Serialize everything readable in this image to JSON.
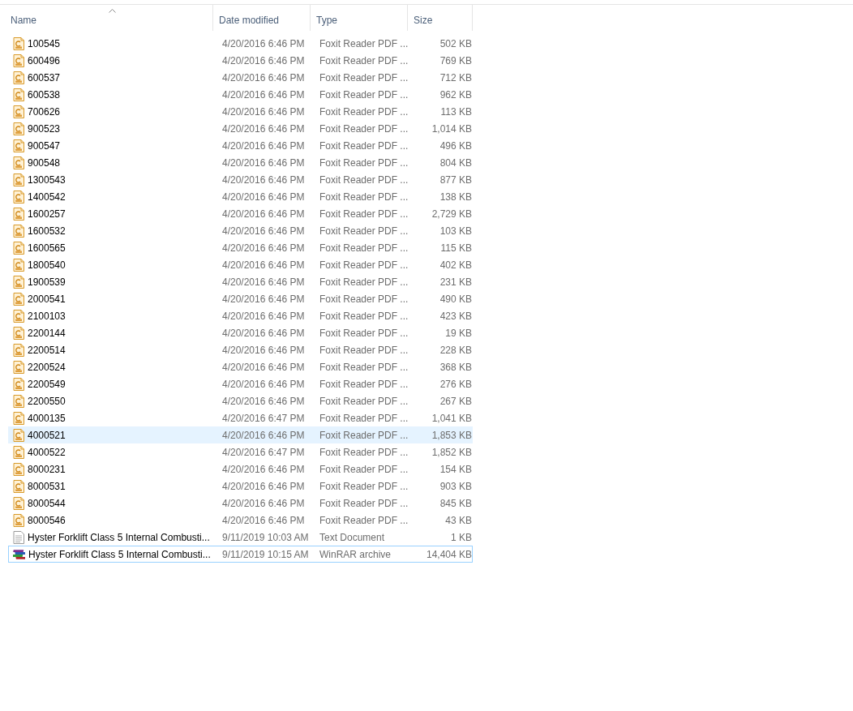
{
  "columns": [
    {
      "label": "Name",
      "sorted": true
    },
    {
      "label": "Date modified",
      "sorted": false
    },
    {
      "label": "Type",
      "sorted": false
    },
    {
      "label": "Size",
      "sorted": false
    }
  ],
  "rows": [
    {
      "kind": "pdf",
      "name": "100545",
      "date": "4/20/2016 6:46 PM",
      "type": "Foxit Reader PDF ...",
      "size": "502 KB",
      "highlighted": false,
      "focused": false
    },
    {
      "kind": "pdf",
      "name": "600496",
      "date": "4/20/2016 6:46 PM",
      "type": "Foxit Reader PDF ...",
      "size": "769 KB",
      "highlighted": false,
      "focused": false
    },
    {
      "kind": "pdf",
      "name": "600537",
      "date": "4/20/2016 6:46 PM",
      "type": "Foxit Reader PDF ...",
      "size": "712 KB",
      "highlighted": false,
      "focused": false
    },
    {
      "kind": "pdf",
      "name": "600538",
      "date": "4/20/2016 6:46 PM",
      "type": "Foxit Reader PDF ...",
      "size": "962 KB",
      "highlighted": false,
      "focused": false
    },
    {
      "kind": "pdf",
      "name": "700626",
      "date": "4/20/2016 6:46 PM",
      "type": "Foxit Reader PDF ...",
      "size": "113 KB",
      "highlighted": false,
      "focused": false
    },
    {
      "kind": "pdf",
      "name": "900523",
      "date": "4/20/2016 6:46 PM",
      "type": "Foxit Reader PDF ...",
      "size": "1,014 KB",
      "highlighted": false,
      "focused": false
    },
    {
      "kind": "pdf",
      "name": "900547",
      "date": "4/20/2016 6:46 PM",
      "type": "Foxit Reader PDF ...",
      "size": "496 KB",
      "highlighted": false,
      "focused": false
    },
    {
      "kind": "pdf",
      "name": "900548",
      "date": "4/20/2016 6:46 PM",
      "type": "Foxit Reader PDF ...",
      "size": "804 KB",
      "highlighted": false,
      "focused": false
    },
    {
      "kind": "pdf",
      "name": "1300543",
      "date": "4/20/2016 6:46 PM",
      "type": "Foxit Reader PDF ...",
      "size": "877 KB",
      "highlighted": false,
      "focused": false
    },
    {
      "kind": "pdf",
      "name": "1400542",
      "date": "4/20/2016 6:46 PM",
      "type": "Foxit Reader PDF ...",
      "size": "138 KB",
      "highlighted": false,
      "focused": false
    },
    {
      "kind": "pdf",
      "name": "1600257",
      "date": "4/20/2016 6:46 PM",
      "type": "Foxit Reader PDF ...",
      "size": "2,729 KB",
      "highlighted": false,
      "focused": false
    },
    {
      "kind": "pdf",
      "name": "1600532",
      "date": "4/20/2016 6:46 PM",
      "type": "Foxit Reader PDF ...",
      "size": "103 KB",
      "highlighted": false,
      "focused": false
    },
    {
      "kind": "pdf",
      "name": "1600565",
      "date": "4/20/2016 6:46 PM",
      "type": "Foxit Reader PDF ...",
      "size": "115 KB",
      "highlighted": false,
      "focused": false
    },
    {
      "kind": "pdf",
      "name": "1800540",
      "date": "4/20/2016 6:46 PM",
      "type": "Foxit Reader PDF ...",
      "size": "402 KB",
      "highlighted": false,
      "focused": false
    },
    {
      "kind": "pdf",
      "name": "1900539",
      "date": "4/20/2016 6:46 PM",
      "type": "Foxit Reader PDF ...",
      "size": "231 KB",
      "highlighted": false,
      "focused": false
    },
    {
      "kind": "pdf",
      "name": "2000541",
      "date": "4/20/2016 6:46 PM",
      "type": "Foxit Reader PDF ...",
      "size": "490 KB",
      "highlighted": false,
      "focused": false
    },
    {
      "kind": "pdf",
      "name": "2100103",
      "date": "4/20/2016 6:46 PM",
      "type": "Foxit Reader PDF ...",
      "size": "423 KB",
      "highlighted": false,
      "focused": false
    },
    {
      "kind": "pdf",
      "name": "2200144",
      "date": "4/20/2016 6:46 PM",
      "type": "Foxit Reader PDF ...",
      "size": "19 KB",
      "highlighted": false,
      "focused": false
    },
    {
      "kind": "pdf",
      "name": "2200514",
      "date": "4/20/2016 6:46 PM",
      "type": "Foxit Reader PDF ...",
      "size": "228 KB",
      "highlighted": false,
      "focused": false
    },
    {
      "kind": "pdf",
      "name": "2200524",
      "date": "4/20/2016 6:46 PM",
      "type": "Foxit Reader PDF ...",
      "size": "368 KB",
      "highlighted": false,
      "focused": false
    },
    {
      "kind": "pdf",
      "name": "2200549",
      "date": "4/20/2016 6:46 PM",
      "type": "Foxit Reader PDF ...",
      "size": "276 KB",
      "highlighted": false,
      "focused": false
    },
    {
      "kind": "pdf",
      "name": "2200550",
      "date": "4/20/2016 6:46 PM",
      "type": "Foxit Reader PDF ...",
      "size": "267 KB",
      "highlighted": false,
      "focused": false
    },
    {
      "kind": "pdf",
      "name": "4000135",
      "date": "4/20/2016 6:47 PM",
      "type": "Foxit Reader PDF ...",
      "size": "1,041 KB",
      "highlighted": false,
      "focused": false
    },
    {
      "kind": "pdf",
      "name": "4000521",
      "date": "4/20/2016 6:46 PM",
      "type": "Foxit Reader PDF ...",
      "size": "1,853 KB",
      "highlighted": true,
      "focused": false
    },
    {
      "kind": "pdf",
      "name": "4000522",
      "date": "4/20/2016 6:47 PM",
      "type": "Foxit Reader PDF ...",
      "size": "1,852 KB",
      "highlighted": false,
      "focused": false
    },
    {
      "kind": "pdf",
      "name": "8000231",
      "date": "4/20/2016 6:46 PM",
      "type": "Foxit Reader PDF ...",
      "size": "154 KB",
      "highlighted": false,
      "focused": false
    },
    {
      "kind": "pdf",
      "name": "8000531",
      "date": "4/20/2016 6:46 PM",
      "type": "Foxit Reader PDF ...",
      "size": "903 KB",
      "highlighted": false,
      "focused": false
    },
    {
      "kind": "pdf",
      "name": "8000544",
      "date": "4/20/2016 6:46 PM",
      "type": "Foxit Reader PDF ...",
      "size": "845 KB",
      "highlighted": false,
      "focused": false
    },
    {
      "kind": "pdf",
      "name": "8000546",
      "date": "4/20/2016 6:46 PM",
      "type": "Foxit Reader PDF ...",
      "size": "43 KB",
      "highlighted": false,
      "focused": false
    },
    {
      "kind": "text",
      "name": "Hyster Forklift Class 5 Internal Combusti...",
      "date": "9/11/2019 10:03 AM",
      "type": "Text Document",
      "size": "1 KB",
      "highlighted": false,
      "focused": false
    },
    {
      "kind": "archive",
      "name": "Hyster Forklift Class 5 Internal Combusti...",
      "date": "9/11/2019 10:15 AM",
      "type": "WinRAR archive",
      "size": "14,404 KB",
      "highlighted": false,
      "focused": true
    }
  ]
}
